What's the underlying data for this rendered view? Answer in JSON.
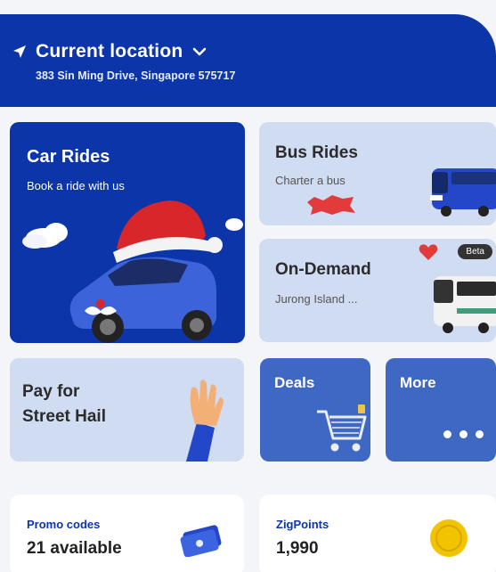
{
  "header": {
    "title": "Current location",
    "address": "383 Sin Ming Drive, Singapore 575717",
    "nav_icon": "navigation-arrow-icon",
    "chevron_icon": "chevron-down-icon"
  },
  "services": {
    "car": {
      "title": "Car Rides",
      "subtitle": "Book a ride with us"
    },
    "bus": {
      "title": "Bus Rides",
      "subtitle": "Charter a bus"
    },
    "on_demand": {
      "title": "On-Demand",
      "subtitle": "Jurong Island ...",
      "badge": "Beta"
    },
    "street_hail": {
      "title_line1": "Pay for",
      "title_line2": "Street Hail"
    },
    "deals": {
      "title": "Deals"
    },
    "more": {
      "title": "More"
    }
  },
  "info": {
    "promo": {
      "label": "Promo codes",
      "value": "21 available"
    },
    "zigpoints": {
      "label": "ZigPoints",
      "value": "1,990"
    }
  },
  "colors": {
    "brand_blue": "#0b35a9",
    "card_light": "#cfdcf2",
    "card_mid": "#3f68c4"
  }
}
